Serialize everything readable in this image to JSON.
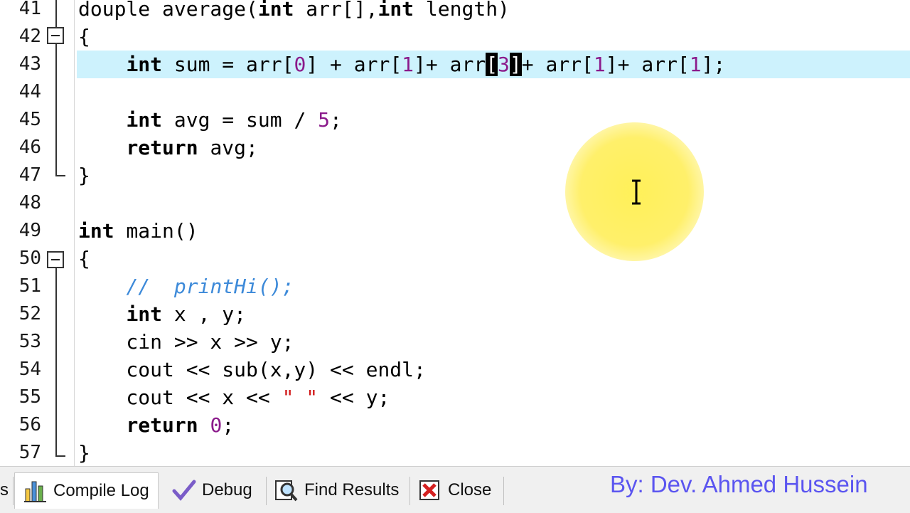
{
  "editor": {
    "lines": [
      {
        "num": "41",
        "tokens": [
          {
            "t": "douple average(",
            "c": ""
          },
          {
            "t": "int",
            "c": "kw"
          },
          {
            "t": " arr[],",
            "c": ""
          },
          {
            "t": "int",
            "c": "kw"
          },
          {
            "t": " length)",
            "c": ""
          }
        ]
      },
      {
        "num": "42",
        "tokens": [
          {
            "t": "{",
            "c": ""
          }
        ]
      },
      {
        "num": "43",
        "tokens": [
          {
            "t": "    ",
            "c": ""
          },
          {
            "t": "int",
            "c": "kw"
          },
          {
            "t": " sum = arr[",
            "c": ""
          },
          {
            "t": "0",
            "c": "num"
          },
          {
            "t": "] + arr[",
            "c": ""
          },
          {
            "t": "1",
            "c": "num"
          },
          {
            "t": "]+ arr",
            "c": ""
          },
          {
            "t": "[",
            "c": "brk"
          },
          {
            "t": "3",
            "c": "num"
          },
          {
            "t": "]",
            "c": "brk"
          },
          {
            "t": "+ arr[",
            "c": ""
          },
          {
            "t": "1",
            "c": "num"
          },
          {
            "t": "]+ arr[",
            "c": ""
          },
          {
            "t": "1",
            "c": "num"
          },
          {
            "t": "];",
            "c": ""
          }
        ]
      },
      {
        "num": "44",
        "tokens": []
      },
      {
        "num": "45",
        "tokens": [
          {
            "t": "    ",
            "c": ""
          },
          {
            "t": "int",
            "c": "kw"
          },
          {
            "t": " avg = sum / ",
            "c": ""
          },
          {
            "t": "5",
            "c": "num"
          },
          {
            "t": ";",
            "c": ""
          }
        ]
      },
      {
        "num": "46",
        "tokens": [
          {
            "t": "    ",
            "c": ""
          },
          {
            "t": "return",
            "c": "kw"
          },
          {
            "t": " avg;",
            "c": ""
          }
        ]
      },
      {
        "num": "47",
        "tokens": [
          {
            "t": "}",
            "c": ""
          }
        ]
      },
      {
        "num": "48",
        "tokens": []
      },
      {
        "num": "49",
        "tokens": [
          {
            "t": "int",
            "c": "kw"
          },
          {
            "t": " main()",
            "c": ""
          }
        ]
      },
      {
        "num": "50",
        "tokens": [
          {
            "t": "{",
            "c": ""
          }
        ]
      },
      {
        "num": "51",
        "tokens": [
          {
            "t": "    ",
            "c": ""
          },
          {
            "t": "//  printHi();",
            "c": "cmt"
          }
        ]
      },
      {
        "num": "52",
        "tokens": [
          {
            "t": "    ",
            "c": ""
          },
          {
            "t": "int",
            "c": "kw"
          },
          {
            "t": " x , y;",
            "c": ""
          }
        ]
      },
      {
        "num": "53",
        "tokens": [
          {
            "t": "    cin >> x >> y;",
            "c": ""
          }
        ]
      },
      {
        "num": "54",
        "tokens": [
          {
            "t": "    cout << sub(x,y) << endl;",
            "c": ""
          }
        ]
      },
      {
        "num": "55",
        "tokens": [
          {
            "t": "    cout << x << ",
            "c": ""
          },
          {
            "t": "\" \"",
            "c": "str"
          },
          {
            "t": " << y;",
            "c": ""
          }
        ]
      },
      {
        "num": "56",
        "tokens": [
          {
            "t": "    ",
            "c": ""
          },
          {
            "t": "return",
            "c": "kw"
          },
          {
            "t": " ",
            "c": ""
          },
          {
            "t": "0",
            "c": "num"
          },
          {
            "t": ";",
            "c": ""
          }
        ]
      },
      {
        "num": "57",
        "tokens": [
          {
            "t": "}",
            "c": ""
          }
        ]
      }
    ],
    "highlighted_line": "43"
  },
  "panel": {
    "tabs": [
      {
        "label": "s",
        "icon": "",
        "active": false
      },
      {
        "label": "Compile Log",
        "icon": "bar-chart-icon",
        "active": true
      },
      {
        "label": "Debug",
        "icon": "check-icon",
        "active": false
      },
      {
        "label": "Find Results",
        "icon": "find-icon",
        "active": false
      },
      {
        "label": "Close",
        "icon": "close-icon",
        "active": false
      }
    ]
  },
  "credit": "By: Dev. Ahmed Hussein",
  "colors": {
    "highlight": "#cdf2fd",
    "number": "#8b1a8b",
    "string": "#d11a1a",
    "comment": "#3d8ad9",
    "credit": "#5b55f0"
  }
}
